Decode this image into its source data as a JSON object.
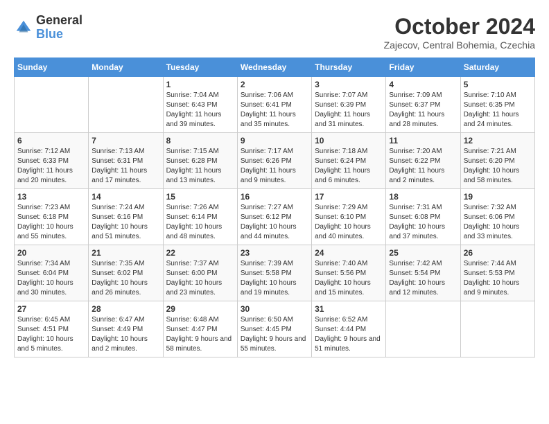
{
  "header": {
    "logo_line1": "General",
    "logo_line2": "Blue",
    "month_year": "October 2024",
    "location": "Zajecov, Central Bohemia, Czechia"
  },
  "days_of_week": [
    "Sunday",
    "Monday",
    "Tuesday",
    "Wednesday",
    "Thursday",
    "Friday",
    "Saturday"
  ],
  "weeks": [
    [
      {
        "day": "",
        "info": ""
      },
      {
        "day": "",
        "info": ""
      },
      {
        "day": "1",
        "info": "Sunrise: 7:04 AM\nSunset: 6:43 PM\nDaylight: 11 hours and 39 minutes."
      },
      {
        "day": "2",
        "info": "Sunrise: 7:06 AM\nSunset: 6:41 PM\nDaylight: 11 hours and 35 minutes."
      },
      {
        "day": "3",
        "info": "Sunrise: 7:07 AM\nSunset: 6:39 PM\nDaylight: 11 hours and 31 minutes."
      },
      {
        "day": "4",
        "info": "Sunrise: 7:09 AM\nSunset: 6:37 PM\nDaylight: 11 hours and 28 minutes."
      },
      {
        "day": "5",
        "info": "Sunrise: 7:10 AM\nSunset: 6:35 PM\nDaylight: 11 hours and 24 minutes."
      }
    ],
    [
      {
        "day": "6",
        "info": "Sunrise: 7:12 AM\nSunset: 6:33 PM\nDaylight: 11 hours and 20 minutes."
      },
      {
        "day": "7",
        "info": "Sunrise: 7:13 AM\nSunset: 6:31 PM\nDaylight: 11 hours and 17 minutes."
      },
      {
        "day": "8",
        "info": "Sunrise: 7:15 AM\nSunset: 6:28 PM\nDaylight: 11 hours and 13 minutes."
      },
      {
        "day": "9",
        "info": "Sunrise: 7:17 AM\nSunset: 6:26 PM\nDaylight: 11 hours and 9 minutes."
      },
      {
        "day": "10",
        "info": "Sunrise: 7:18 AM\nSunset: 6:24 PM\nDaylight: 11 hours and 6 minutes."
      },
      {
        "day": "11",
        "info": "Sunrise: 7:20 AM\nSunset: 6:22 PM\nDaylight: 11 hours and 2 minutes."
      },
      {
        "day": "12",
        "info": "Sunrise: 7:21 AM\nSunset: 6:20 PM\nDaylight: 10 hours and 58 minutes."
      }
    ],
    [
      {
        "day": "13",
        "info": "Sunrise: 7:23 AM\nSunset: 6:18 PM\nDaylight: 10 hours and 55 minutes."
      },
      {
        "day": "14",
        "info": "Sunrise: 7:24 AM\nSunset: 6:16 PM\nDaylight: 10 hours and 51 minutes."
      },
      {
        "day": "15",
        "info": "Sunrise: 7:26 AM\nSunset: 6:14 PM\nDaylight: 10 hours and 48 minutes."
      },
      {
        "day": "16",
        "info": "Sunrise: 7:27 AM\nSunset: 6:12 PM\nDaylight: 10 hours and 44 minutes."
      },
      {
        "day": "17",
        "info": "Sunrise: 7:29 AM\nSunset: 6:10 PM\nDaylight: 10 hours and 40 minutes."
      },
      {
        "day": "18",
        "info": "Sunrise: 7:31 AM\nSunset: 6:08 PM\nDaylight: 10 hours and 37 minutes."
      },
      {
        "day": "19",
        "info": "Sunrise: 7:32 AM\nSunset: 6:06 PM\nDaylight: 10 hours and 33 minutes."
      }
    ],
    [
      {
        "day": "20",
        "info": "Sunrise: 7:34 AM\nSunset: 6:04 PM\nDaylight: 10 hours and 30 minutes."
      },
      {
        "day": "21",
        "info": "Sunrise: 7:35 AM\nSunset: 6:02 PM\nDaylight: 10 hours and 26 minutes."
      },
      {
        "day": "22",
        "info": "Sunrise: 7:37 AM\nSunset: 6:00 PM\nDaylight: 10 hours and 23 minutes."
      },
      {
        "day": "23",
        "info": "Sunrise: 7:39 AM\nSunset: 5:58 PM\nDaylight: 10 hours and 19 minutes."
      },
      {
        "day": "24",
        "info": "Sunrise: 7:40 AM\nSunset: 5:56 PM\nDaylight: 10 hours and 15 minutes."
      },
      {
        "day": "25",
        "info": "Sunrise: 7:42 AM\nSunset: 5:54 PM\nDaylight: 10 hours and 12 minutes."
      },
      {
        "day": "26",
        "info": "Sunrise: 7:44 AM\nSunset: 5:53 PM\nDaylight: 10 hours and 9 minutes."
      }
    ],
    [
      {
        "day": "27",
        "info": "Sunrise: 6:45 AM\nSunset: 4:51 PM\nDaylight: 10 hours and 5 minutes."
      },
      {
        "day": "28",
        "info": "Sunrise: 6:47 AM\nSunset: 4:49 PM\nDaylight: 10 hours and 2 minutes."
      },
      {
        "day": "29",
        "info": "Sunrise: 6:48 AM\nSunset: 4:47 PM\nDaylight: 9 hours and 58 minutes."
      },
      {
        "day": "30",
        "info": "Sunrise: 6:50 AM\nSunset: 4:45 PM\nDaylight: 9 hours and 55 minutes."
      },
      {
        "day": "31",
        "info": "Sunrise: 6:52 AM\nSunset: 4:44 PM\nDaylight: 9 hours and 51 minutes."
      },
      {
        "day": "",
        "info": ""
      },
      {
        "day": "",
        "info": ""
      }
    ]
  ]
}
